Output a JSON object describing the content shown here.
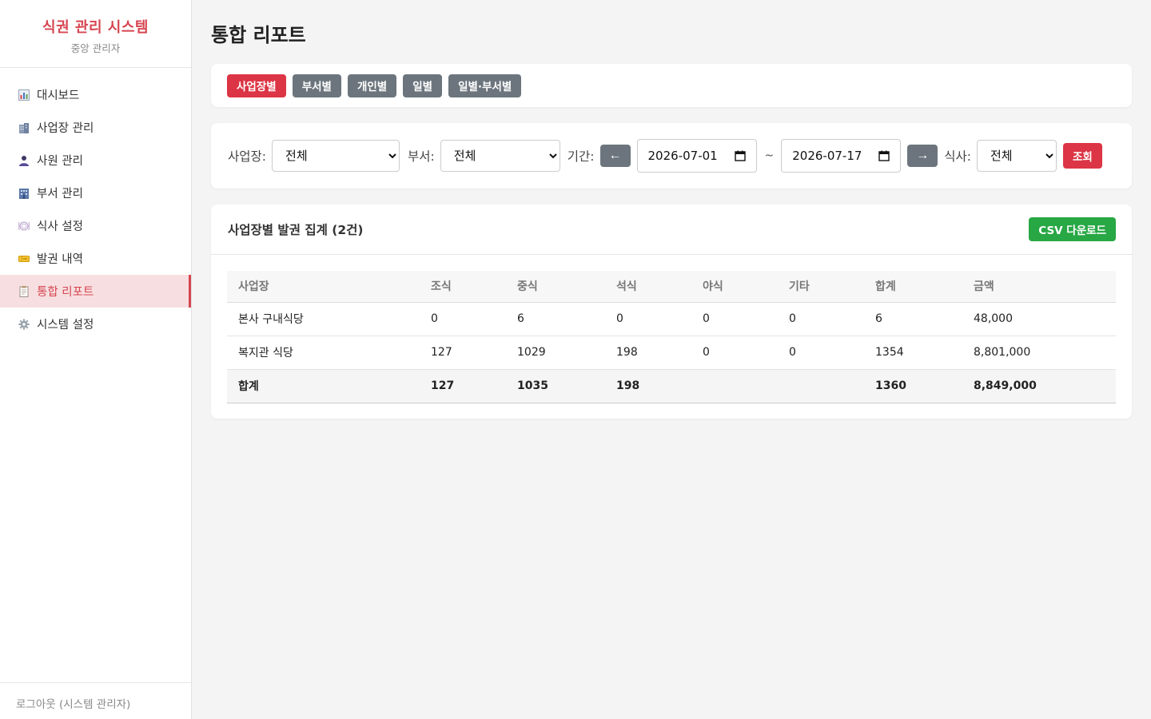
{
  "sidebar": {
    "title": "식권 관리 시스템",
    "subtitle": "중앙 관리자",
    "items": [
      {
        "label": "대시보드",
        "icon": "chart-icon"
      },
      {
        "label": "사업장 관리",
        "icon": "building-icon"
      },
      {
        "label": "사원 관리",
        "icon": "person-icon"
      },
      {
        "label": "부서 관리",
        "icon": "office-icon"
      },
      {
        "label": "식사 설정",
        "icon": "plate-icon"
      },
      {
        "label": "발권 내역",
        "icon": "ticket-icon"
      },
      {
        "label": "통합 리포트",
        "icon": "report-icon",
        "active": true
      },
      {
        "label": "시스템 설정",
        "icon": "gear-icon"
      }
    ],
    "logout": "로그아웃 (시스템 관리자)"
  },
  "page": {
    "title": "통합 리포트"
  },
  "tabs": [
    "사업장별",
    "부서별",
    "개인별",
    "일별",
    "일별·부서별"
  ],
  "active_tab": "사업장별",
  "filter": {
    "site_label": "사업장:",
    "site_value": "전체",
    "dept_label": "부서:",
    "dept_value": "전체",
    "period_label": "기간:",
    "prev_arrow": "←",
    "start_date": "2026-07-01",
    "tilde": "~",
    "end_date": "2026-07-17",
    "next_arrow": "→",
    "meal_label": "식사:",
    "meal_value": "전체",
    "search_label": "조회"
  },
  "result": {
    "title": "사업장별 발권 집계 (2건)",
    "csv_label": "CSV 다운로드",
    "columns": [
      "사업장",
      "조식",
      "중식",
      "석식",
      "야식",
      "기타",
      "합계",
      "금액"
    ],
    "rows": [
      [
        "본사 구내식당",
        "0",
        "6",
        "0",
        "0",
        "0",
        "6",
        "48,000"
      ],
      [
        "복지관 식당",
        "127",
        "1029",
        "198",
        "0",
        "0",
        "1354",
        "8,801,000"
      ]
    ],
    "total": [
      "합계",
      "127",
      "1035",
      "198",
      "",
      "",
      "1360",
      "8,849,000"
    ]
  },
  "colors": {
    "accent": "#dc3545",
    "secondary": "#6c757d",
    "success": "#28a745",
    "active_bg": "#f7dfe1"
  }
}
